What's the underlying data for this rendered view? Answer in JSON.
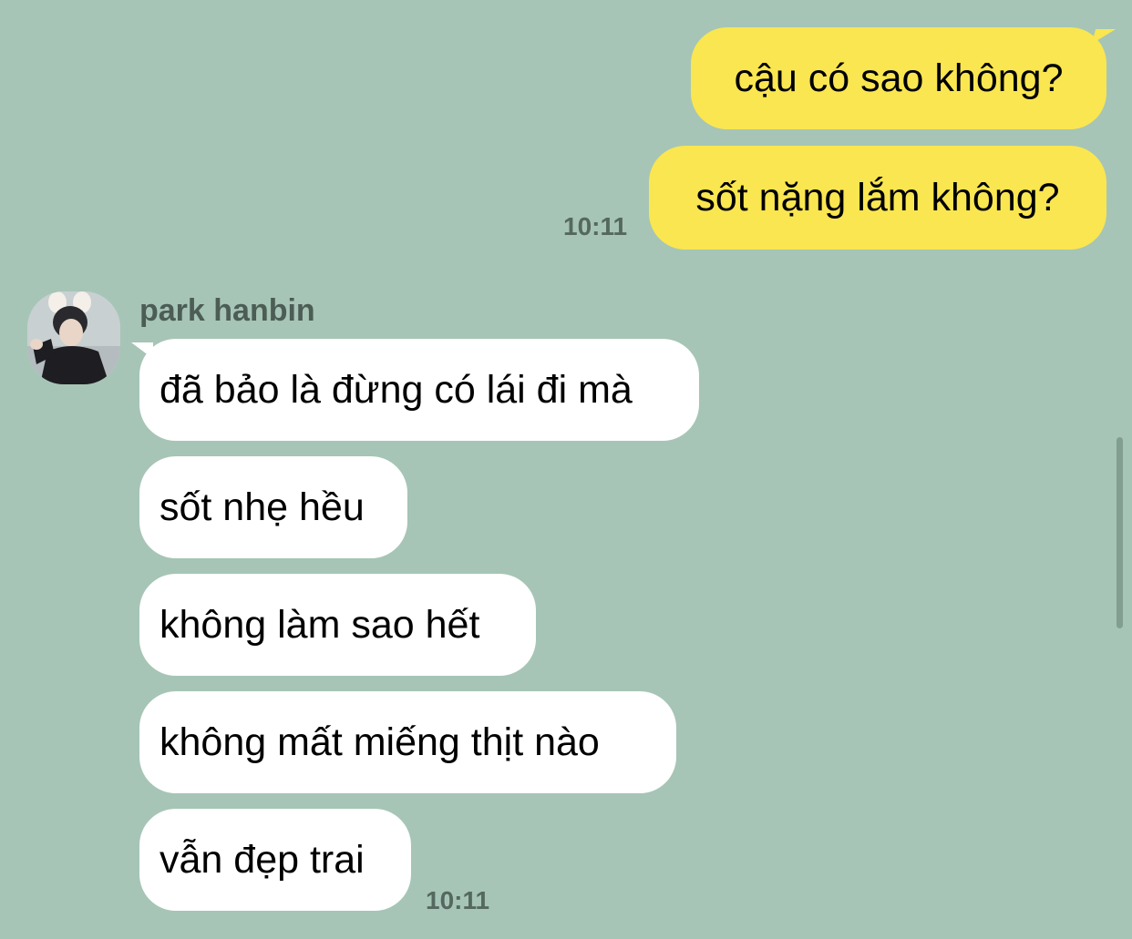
{
  "chat": {
    "outgoing": [
      {
        "text": "cậu có sao không?"
      },
      {
        "text": "sốt nặng lắm không?"
      }
    ],
    "outgoing_time": "10:11",
    "sender_name": "park hanbin",
    "incoming": [
      {
        "text": "đã bảo là đừng có lái đi mà"
      },
      {
        "text": "sốt nhẹ hều"
      },
      {
        "text": "không làm sao hết"
      },
      {
        "text": "không mất miếng thịt nào"
      },
      {
        "text": "vẫn đẹp trai"
      }
    ],
    "incoming_time": "10:11"
  },
  "colors": {
    "background": "#a6c5b6",
    "outgoing_bubble": "#fae650",
    "incoming_bubble": "#ffffff"
  },
  "icons": {
    "avatar": "profile-photo"
  }
}
